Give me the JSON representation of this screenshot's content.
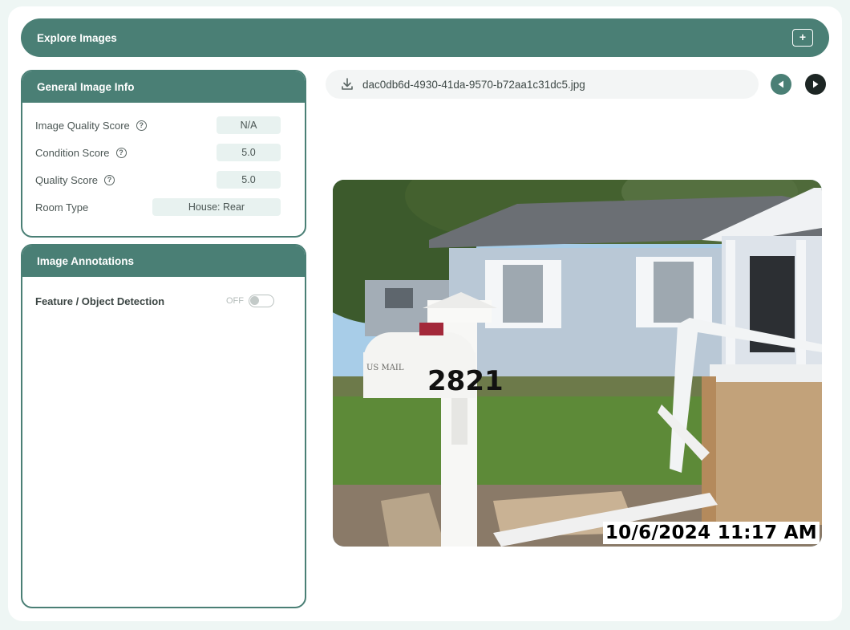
{
  "header": {
    "title": "Explore Images",
    "add_label": "+"
  },
  "general_info": {
    "title": "General Image Info",
    "rows": [
      {
        "label": "Image Quality Score",
        "value": "N/A",
        "has_help": true
      },
      {
        "label": "Condition Score",
        "value": "5.0",
        "has_help": true
      },
      {
        "label": "Quality Score",
        "value": "5.0",
        "has_help": true
      },
      {
        "label": "Room Type",
        "value": "House: Rear",
        "has_help": false
      }
    ]
  },
  "annotations": {
    "title": "Image Annotations",
    "feature_label": "Feature / Object Detection",
    "toggle_state": "OFF"
  },
  "file": {
    "name": "dac0db6d-4930-41da-9570-b72aa1c31dc5.jpg"
  },
  "photo": {
    "timestamp": "10/6/2024 11:17 AM",
    "mailbox_number": "2821",
    "mailbox_text": "US MAIL"
  },
  "colors": {
    "accent": "#4a7f75",
    "dark": "#1d2624",
    "pill": "#e8f2f0"
  },
  "icons": [
    "plus-icon",
    "help-icon",
    "download-icon",
    "play-left-icon",
    "play-right-icon"
  ]
}
